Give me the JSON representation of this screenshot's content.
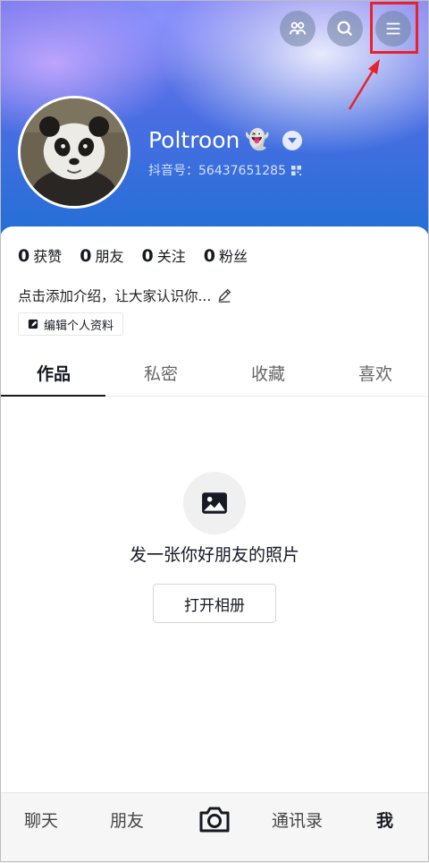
{
  "header": {
    "username": "Poltroon",
    "username_emoji": "👻",
    "douyin_id": "抖音号：56437651285",
    "buttons": [
      "friends-icon",
      "search-icon",
      "menu-icon"
    ]
  },
  "stats": [
    {
      "value": "0",
      "label": "获赞"
    },
    {
      "value": "0",
      "label": "朋友"
    },
    {
      "value": "0",
      "label": "关注"
    },
    {
      "value": "0",
      "label": "粉丝"
    }
  ],
  "bio": "点击添加介绍，让大家认识你...",
  "edit_profile": "编辑个人资料",
  "tabs": [
    "作品",
    "私密",
    "收藏",
    "喜欢"
  ],
  "empty_state": {
    "title": "发一张你好朋友的照片",
    "button": "打开相册"
  },
  "bottom_nav": [
    "聊天",
    "朋友",
    "通讯录",
    "我"
  ],
  "colors": {
    "highlight": "#e8212e",
    "header_blue": "#1f6fd4"
  }
}
